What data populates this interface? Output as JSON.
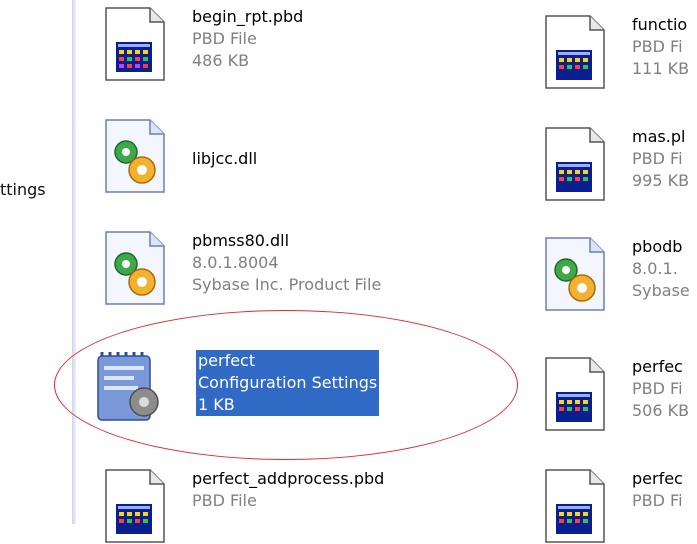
{
  "sidebar": {
    "partial_label": "ttings"
  },
  "left_files": [
    {
      "name": "begin_rpt.pbd",
      "type": "PBD File",
      "size": "486 KB",
      "icon": "pbd-file-icon"
    },
    {
      "name": "libjcc.dll",
      "type": "",
      "size": "",
      "icon": "dll-gear-icon"
    },
    {
      "name": "pbmss80.dll",
      "type": "8.0.1.8004",
      "size": "Sybase Inc. Product File",
      "icon": "dll-gear-icon"
    },
    {
      "name": "perfect",
      "type": "Configuration Settings",
      "size": "1 KB",
      "icon": "config-settings-icon",
      "selected": true
    },
    {
      "name": "perfect_addprocess.pbd",
      "type": "PBD File",
      "size": "",
      "icon": "pbd-file-icon"
    }
  ],
  "right_files": [
    {
      "name": "functio",
      "type": "PBD Fi",
      "size": "111 KB",
      "icon": "pbd-file-icon"
    },
    {
      "name": "mas.pl",
      "type": "PBD Fi",
      "size": "995 KB",
      "icon": "pbd-file-icon"
    },
    {
      "name": "pbodb",
      "type": "8.0.1.",
      "size": "Sybase",
      "icon": "dll-gear-icon"
    },
    {
      "name": "perfec",
      "type": "PBD Fi",
      "size": "506 KB",
      "icon": "pbd-file-icon"
    },
    {
      "name": "perfec",
      "type": "PBD Fi",
      "size": "",
      "icon": "pbd-file-icon"
    }
  ],
  "colors": {
    "selection": "#316ac5",
    "annotation": "#e32a2a",
    "secondary_text": "#808080"
  }
}
